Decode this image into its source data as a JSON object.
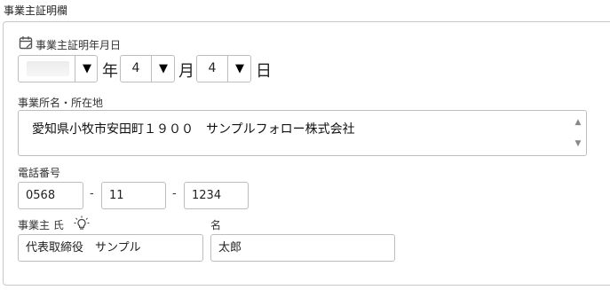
{
  "section": {
    "title": "事業主証明欄"
  },
  "certification_date": {
    "label": "事業主証明年月日",
    "year": {
      "value": "",
      "unit": "年"
    },
    "month": {
      "value": "4",
      "unit": "月"
    },
    "day": {
      "value": "4",
      "unit": "日"
    },
    "arrow_glyph": "▼"
  },
  "address": {
    "label": "事業所名・所在地",
    "value": "愛知県小牧市安田町１９００　サンプルフォロー株式会社"
  },
  "phone": {
    "label": "電話番号",
    "part1": "0568",
    "part2": "11",
    "part3": "1234",
    "separator": "-"
  },
  "employer": {
    "last_name_label": "事業主 氏",
    "last_name": "代表取締役　サンプル",
    "first_name_label": "名",
    "first_name": "太郎"
  },
  "icons": {
    "calendar": "calendar-icon",
    "bulb": "lightbulb-icon"
  }
}
